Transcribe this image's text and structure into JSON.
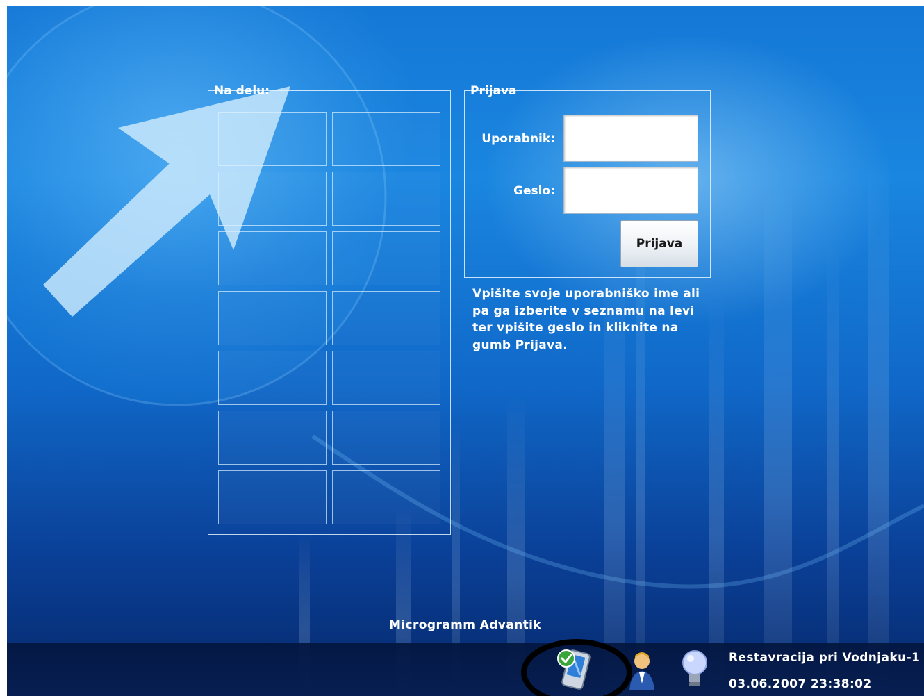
{
  "login_screen": {
    "active_panel": {
      "legend": "Na delu:",
      "user_slots": [
        "",
        "",
        "",
        "",
        "",
        "",
        "",
        "",
        "",
        "",
        "",
        "",
        "",
        ""
      ]
    },
    "login_panel": {
      "legend": "Prijava",
      "username_label": "Uporabnik:",
      "username_value": "",
      "password_label": "Geslo:",
      "password_value": "",
      "submit_label": "Prijava"
    },
    "help_text": "Vpišite svoje uporabniško ime ali pa ga izberite v seznamu na levi ter vpišite geslo in kliknite na gumb Prijava.",
    "product_name": "Microgramm Advantik"
  },
  "taskbar": {
    "icons": [
      "mobile-device-check-icon",
      "user-icon",
      "lightbulb-icon"
    ],
    "location": "Restavracija pri Vodnjaku-1",
    "datetime": "03.06.2007 23:38:02"
  },
  "colors": {
    "background_top": "#1478d6",
    "background_bottom": "#06286a",
    "taskbar": "#061e50",
    "text": "#ffffff",
    "annotation": "#000000"
  }
}
